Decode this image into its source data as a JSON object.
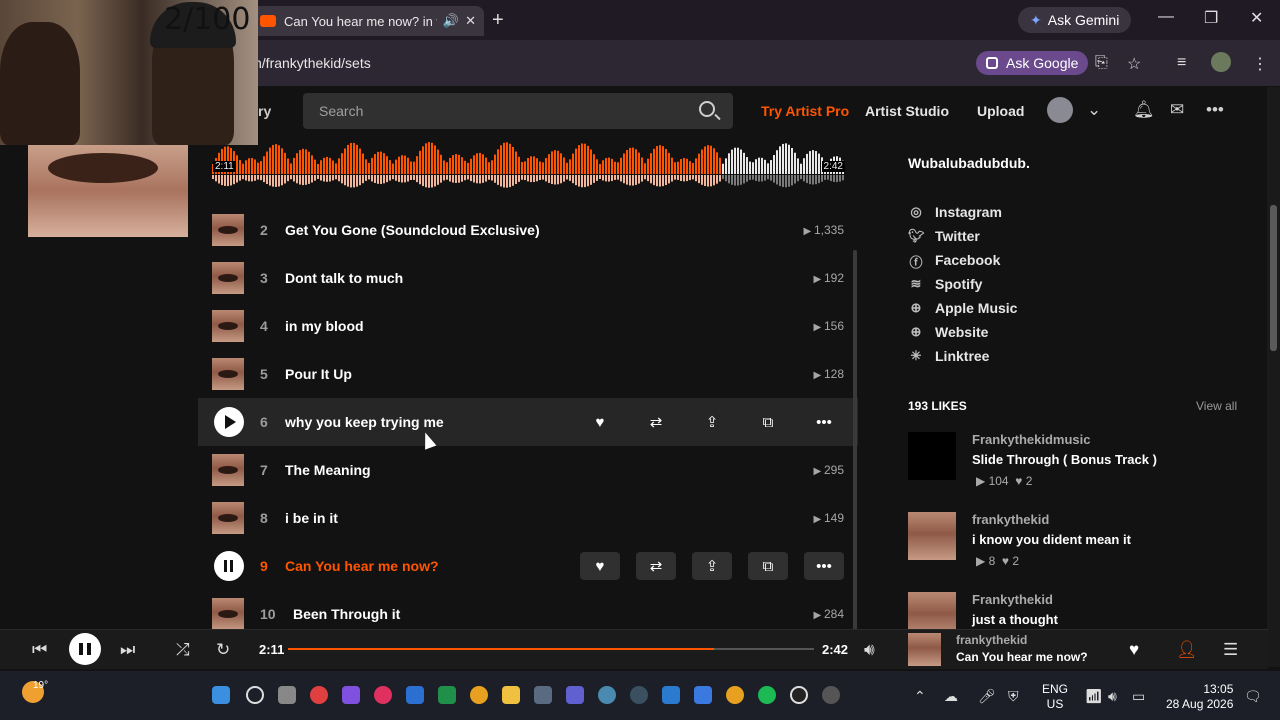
{
  "browser": {
    "tab_title": "Can You hear me now? in w",
    "ask_gemini": "Ask Gemini",
    "url": "n/frankythekid/sets",
    "ask_google": "Ask Google"
  },
  "webcam": {
    "counter": "2/100"
  },
  "header": {
    "nav_fragment": "ry",
    "search_placeholder": "Search",
    "try_pro": "Try Artist Pro",
    "artist_studio": "Artist Studio",
    "upload": "Upload"
  },
  "waveform": {
    "elapsed": "2:11",
    "duration": "2:42",
    "progress": 0.81
  },
  "tracks": [
    {
      "num": "2",
      "title": "Get You Gone (Soundcloud Exclusive)",
      "plays": "1,335"
    },
    {
      "num": "3",
      "title": "Dont talk to much",
      "plays": "192"
    },
    {
      "num": "4",
      "title": "in my blood",
      "plays": "156"
    },
    {
      "num": "5",
      "title": "Pour It Up",
      "plays": "128"
    },
    {
      "num": "6",
      "title": "why you keep trying me",
      "plays": ""
    },
    {
      "num": "7",
      "title": "The Meaning",
      "plays": "295"
    },
    {
      "num": "8",
      "title": "i be in it",
      "plays": "149"
    },
    {
      "num": "9",
      "title": "Can You hear me now?",
      "plays": ""
    },
    {
      "num": "10",
      "title": "Been Through it",
      "plays": "284"
    }
  ],
  "sidebar": {
    "bio": "Wubalubadubdub.",
    "links": [
      {
        "icon": "instagram-icon",
        "label": "Instagram"
      },
      {
        "icon": "twitter-icon",
        "label": "Twitter"
      },
      {
        "icon": "facebook-icon",
        "label": "Facebook"
      },
      {
        "icon": "spotify-icon",
        "label": "Spotify"
      },
      {
        "icon": "globe-icon",
        "label": "Apple Music"
      },
      {
        "icon": "globe-icon",
        "label": "Website"
      },
      {
        "icon": "linktree-icon",
        "label": "Linktree"
      }
    ],
    "likes_heading": "193 LIKES",
    "view_all": "View all",
    "likes": [
      {
        "artist": "Frankythekidmusic",
        "title": "Slide Through ( Bonus Track )",
        "plays": "104",
        "likes": "2"
      },
      {
        "artist": "frankythekid",
        "title": "i know you dident mean it",
        "plays": "8",
        "likes": "2"
      },
      {
        "artist": "Frankythekid",
        "title": "just a thought",
        "plays": "",
        "likes": ""
      }
    ]
  },
  "player": {
    "elapsed": "2:11",
    "duration": "2:42",
    "progress": 0.81,
    "artist": "frankythekid",
    "title": "Can You hear me now?"
  },
  "taskbar": {
    "temperature": "19°",
    "lang1": "ENG",
    "lang2": "US",
    "time": "13:05",
    "date": "28 Aug 2026"
  },
  "colors": {
    "accent": "#ff5500",
    "background": "#121212"
  }
}
